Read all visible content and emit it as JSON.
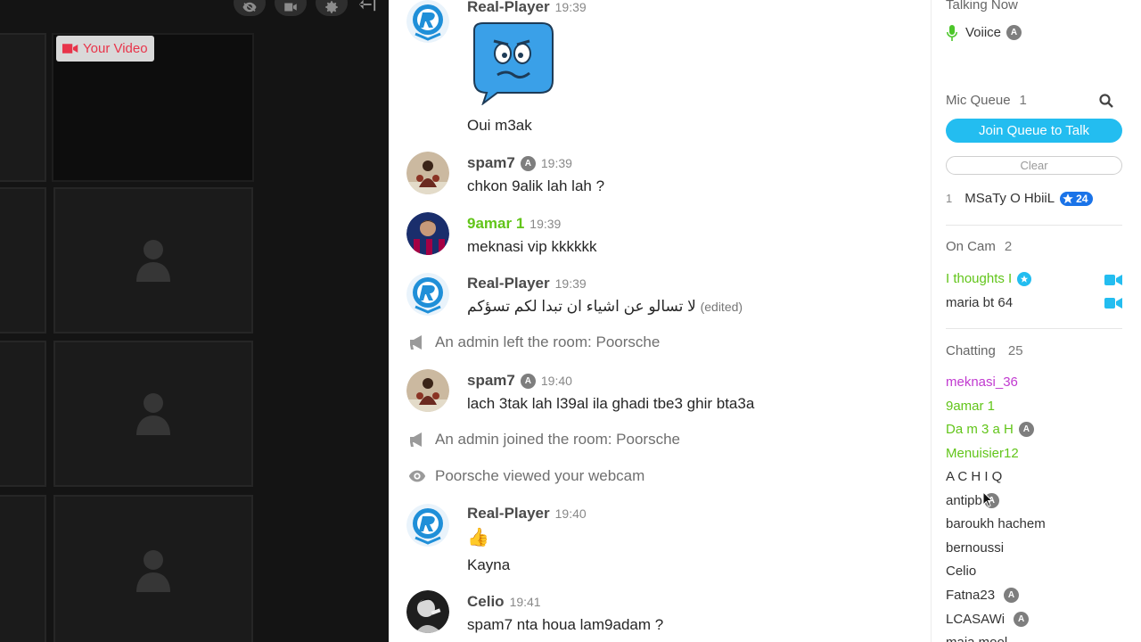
{
  "video": {
    "your_video_label": "Your Video"
  },
  "messages": [
    {
      "user": "Real-Player",
      "time": "19:39",
      "text": "Oui m3ak"
    },
    {
      "user": "spam7",
      "time": "19:39",
      "text": "chkon 9alik lah lah ?"
    },
    {
      "user": "9amar 1",
      "time": "19:39",
      "text": "meknasi vip kkkkkk"
    },
    {
      "user": "Real-Player",
      "time": "19:39",
      "text": "لا تسالو عن اشياء ان تبدا لكم تسؤكم",
      "edited": "(edited)"
    },
    {
      "user": "spam7",
      "time": "19:40",
      "text": "lach 3tak lah l39al ila ghadi tbe3 ghir bta3a"
    },
    {
      "user": "Real-Player",
      "time": "19:40",
      "emoji": "👍",
      "text": "Kayna"
    },
    {
      "user": "Celio",
      "time": "19:41",
      "text": "spam7 nta houa lam9adam ?"
    }
  ],
  "system": [
    "An admin left the room: Poorsche",
    "An admin joined the room: Poorsche",
    "Poorsche viewed your webcam"
  ],
  "admin_badge": "A",
  "sidebar": {
    "talking_now": {
      "title": "Talking Now",
      "user": "Voiice"
    },
    "mic_queue": {
      "title": "Mic Queue",
      "count": "1",
      "join_label": "Join Queue to Talk",
      "clear_label": "Clear",
      "entries": [
        {
          "index": "1",
          "name": "MSaTy O HbiiL",
          "rank": "24"
        }
      ]
    },
    "on_cam": {
      "title": "On Cam",
      "count": "2",
      "users": [
        "I thoughts I",
        "maria bt 64"
      ]
    },
    "chatting": {
      "title": "Chatting",
      "count": "25",
      "users": [
        "meknasi_36",
        "9amar 1",
        "Da m 3 a H",
        "Menuisier12",
        "A C H I Q",
        "antipb",
        "baroukh hachem",
        "bernoussi",
        "Celio",
        "Fatna23",
        "LCASAWi",
        "maja mool"
      ]
    }
  },
  "colors": {
    "accent": "#23bdf0",
    "green": "#62c51a",
    "purple": "#c13ad0",
    "red": "#e8344a"
  }
}
